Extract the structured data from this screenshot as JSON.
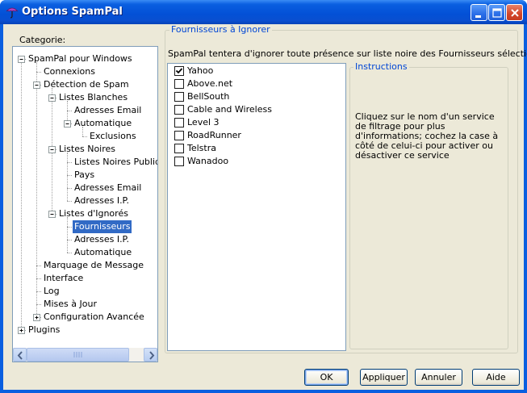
{
  "window": {
    "title": "Options SpamPal",
    "icon": "umbrella-icon"
  },
  "titlebar_buttons": {
    "minimize": "minimize-icon",
    "maximize": "maximize-icon",
    "close": "close-icon"
  },
  "category_label": "Categorie:",
  "tree": {
    "nodes": [
      {
        "label": "SpamPal pour Windows",
        "expanded": true
      },
      {
        "label": "Connexions"
      },
      {
        "label": "Détection de Spam",
        "expanded": true
      },
      {
        "label": "Listes Blanches",
        "expanded": true
      },
      {
        "label": "Adresses Email"
      },
      {
        "label": "Automatique",
        "expanded": true
      },
      {
        "label": "Exclusions"
      },
      {
        "label": "Listes Noires",
        "expanded": true
      },
      {
        "label": "Listes Noires Publiques"
      },
      {
        "label": "Pays"
      },
      {
        "label": "Adresses Email"
      },
      {
        "label": "Adresses I.P."
      },
      {
        "label": "Listes d'Ignorés",
        "expanded": true
      },
      {
        "label": "Fournisseurs",
        "selected": true
      },
      {
        "label": "Adresses I.P."
      },
      {
        "label": "Automatique"
      },
      {
        "label": "Marquage de Message"
      },
      {
        "label": "Interface"
      },
      {
        "label": "Log"
      },
      {
        "label": "Mises à Jour"
      },
      {
        "label": "Configuration Avancée",
        "expanded": false
      },
      {
        "label": "Plugins",
        "expanded": false
      }
    ]
  },
  "panel": {
    "legend": "Fournisseurs à Ignorer",
    "description": "SpamPal tentera d'ignorer toute présence sur liste noire des Fournisseurs sélectionnés ici.",
    "providers": [
      {
        "label": "Yahoo",
        "checked": true
      },
      {
        "label": "Above.net",
        "checked": false
      },
      {
        "label": "BellSouth",
        "checked": false
      },
      {
        "label": "Cable and Wireless",
        "checked": false
      },
      {
        "label": "Level 3",
        "checked": false
      },
      {
        "label": "RoadRunner",
        "checked": false
      },
      {
        "label": "Telstra",
        "checked": false
      },
      {
        "label": "Wanadoo",
        "checked": false
      }
    ],
    "instructions_legend": "Instructions",
    "instructions_text": "Cliquez sur le nom d'un service de filtrage pour plus d'informations; cochez la case à côté de celui-ci pour activer ou désactiver ce service"
  },
  "buttons": {
    "ok": "OK",
    "apply": "Appliquer",
    "cancel": "Annuler",
    "help": "Aide"
  },
  "colors": {
    "titlebar": "#0a5fe0",
    "selection": "#316ac5",
    "legend": "#0046d5",
    "face": "#ece9d8"
  }
}
